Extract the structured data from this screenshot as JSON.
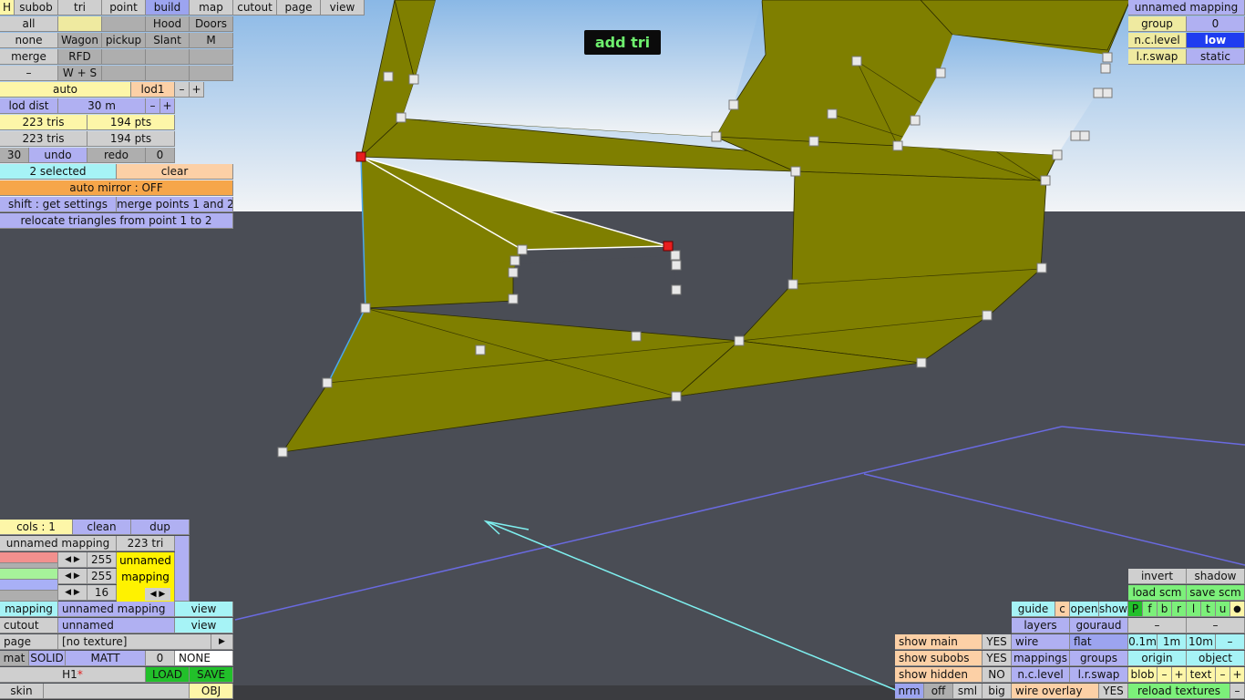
{
  "overlay": {
    "mode_label": "add tri"
  },
  "top_tabs": [
    "H",
    "subob",
    "tri",
    "point",
    "build",
    "map",
    "cutout",
    "page",
    "view"
  ],
  "left_panel": {
    "row2": [
      "all",
      "",
      "Hood",
      "Doors"
    ],
    "row3": [
      "none",
      "Wagon",
      "pickup",
      "Slant",
      "M"
    ],
    "row4": [
      "merge",
      "RFD"
    ],
    "row5": [
      "–",
      "W + S"
    ],
    "lod": {
      "auto": "auto",
      "lod1": "lod1",
      "minus": "–",
      "plus": "+"
    },
    "lod_dist": {
      "label": "lod dist",
      "value": "30 m",
      "minus": "–",
      "plus": "+"
    },
    "stats1": {
      "tris": "223 tris",
      "pts": "194 pts"
    },
    "stats2": {
      "tris": "223 tris",
      "pts": "194 pts"
    },
    "undo_row": {
      "count": "30",
      "undo": "undo",
      "redo": "redo",
      "redo_count": "0"
    },
    "selection": {
      "selected": "2 selected",
      "clear": "clear"
    },
    "auto_mirror": "auto mirror : OFF",
    "shift_row": {
      "get": "shift : get settings",
      "merge": "merge points 1 and 2"
    },
    "relocate": "relocate triangles from point 1 to 2"
  },
  "top_right": {
    "mapping": "unnamed mapping",
    "group_label": "group",
    "group_value": "0",
    "nc_label": "n.c.level",
    "nc_value": "low",
    "lr_label": "l.r.swap",
    "lr_value": "static"
  },
  "bottom_left": {
    "cols": "cols : 1",
    "clean": "clean",
    "dup": "dup",
    "mapping_name": "unnamed mapping",
    "tri_count": "223 tri",
    "red_val": "255",
    "green_val": "255",
    "blue_val": "16",
    "swatch_line1": "unnamed",
    "swatch_line2": "mapping",
    "mapping_label": "mapping",
    "mapping_value": "unnamed mapping",
    "mapping_view": "view",
    "cutout_label": "cutout",
    "cutout_value": "unnamed",
    "cutout_view": "view",
    "page_label": "page",
    "page_value": "[no texture]",
    "page_arrow": "▶",
    "mat_label": "mat",
    "mat_solid": "SOLID",
    "mat_matt": "MATT",
    "mat_zero": "0",
    "mat_none": "NONE",
    "file_name": "H1",
    "file_star": "*",
    "load": "LOAD",
    "save": "SAVE",
    "skin": "skin",
    "obj": "OBJ"
  },
  "bottom_right": {
    "invert": "invert",
    "shadow": "shadow",
    "load_scm": "load scm",
    "save_scm": "save scm",
    "guide": "guide",
    "c": "c",
    "open": "open",
    "show": "show",
    "letters": [
      "P",
      "f",
      "b",
      "r",
      "l",
      "t",
      "u"
    ],
    "dot": "●",
    "layers": "layers",
    "gouraud": "gouraud",
    "dash1": "–",
    "dash2": "–",
    "show_main": "show main",
    "show_main_v": "YES",
    "wire": "wire",
    "flat": "flat",
    "d01": "0.1m",
    "d1": "1m",
    "d10": "10m",
    "dminus": "–",
    "show_subobs": "show subobs",
    "show_subobs_v": "YES",
    "mappings": "mappings",
    "groups": "groups",
    "origin": "origin",
    "object": "object",
    "show_hidden": "show hidden",
    "show_hidden_v": "NO",
    "nc_level": "n.c.level",
    "lr_swap": "l.r.swap",
    "blob": "blob",
    "bminus": "–",
    "bplus": "+",
    "text": "text",
    "tminus": "–",
    "tplus": "+",
    "nrm": "nrm",
    "off": "off",
    "sml": "sml",
    "big": "big",
    "wire_overlay": "wire overlay",
    "wire_overlay_v": "YES",
    "reload": "reload textures",
    "rminus": "–"
  }
}
